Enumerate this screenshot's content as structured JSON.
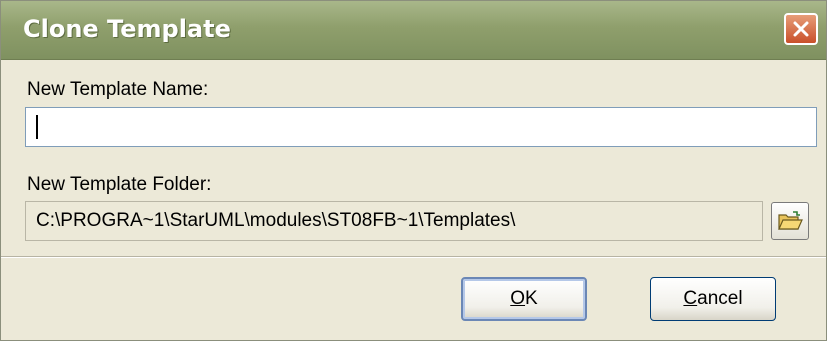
{
  "dialog": {
    "title": "Clone Template",
    "close_icon": "close-icon"
  },
  "form": {
    "name_label": "New Template Name:",
    "name_value": "",
    "folder_label": "New Template Folder:",
    "folder_value": "C:\\PROGRA~1\\StarUML\\modules\\ST08FB~1\\Templates\\",
    "browse_icon": "folder-open-icon"
  },
  "buttons": {
    "ok_mnemonic": "O",
    "ok_rest": "K",
    "cancel_mnemonic": "C",
    "cancel_rest": "ancel"
  },
  "colors": {
    "titlebar": "#8f9f6c",
    "close_button": "#c9502a",
    "dialog_bg": "#ece9d8",
    "default_button_border": "#6b87b5"
  }
}
